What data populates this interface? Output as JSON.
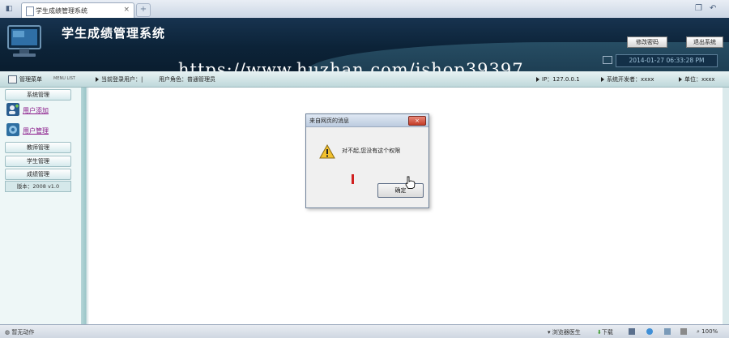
{
  "browser": {
    "tab_title": "学生成绩管理系统",
    "tab_close": "×",
    "new_tab": "+",
    "status_text": "暂无动作",
    "status_items": [
      "浏览器医生",
      "下载"
    ],
    "zoom": "100%"
  },
  "header": {
    "app_title": "学生成绩管理系统",
    "change_password": "修改密码",
    "exit_system": "退出系统",
    "datetime": "2014-01-27 06:33:28 PM",
    "watermark": "https://www.huzhan.com/ishop39397"
  },
  "infobar": {
    "menu_title": "管理菜单",
    "menu_subtitle": "MENU LIST",
    "current_user": "当前登录用户：|",
    "user_role": "用户角色：普通管理员",
    "ip": "IP：127.0.0.1",
    "developer": "系统开发者：xxxx",
    "unit": "单位：xxxx"
  },
  "sidebar": {
    "system_manage": "系统管理",
    "links": [
      {
        "label": "用户添加",
        "icon": "user-add-icon"
      },
      {
        "label": "用户管理",
        "icon": "user-manage-icon"
      }
    ],
    "groups": [
      "教师管理",
      "学生管理",
      "成绩管理"
    ],
    "version": "版本：2008 v1.0"
  },
  "dialog": {
    "title": "来自网页的消息",
    "close": "×",
    "message": "对不起,您没有这个权限",
    "ok": "确定"
  },
  "colors": {
    "header_bg": "#0c2338",
    "infobar_bg": "#c9e0e3",
    "sidebar_bg": "#eef7f7",
    "link_color": "#8a1a8a",
    "dialog_close": "#c43c27"
  }
}
